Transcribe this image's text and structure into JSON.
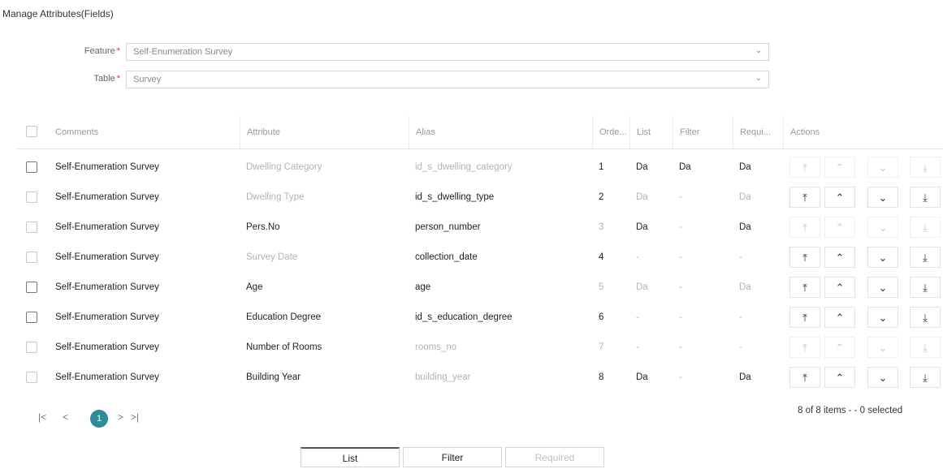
{
  "page": {
    "title": "Manage Attributes(Fields)"
  },
  "form": {
    "feature": {
      "label": "Feature",
      "value": "Self-Enumeration Survey"
    },
    "table": {
      "label": "Table",
      "value": "Survey"
    },
    "required_mark": "*"
  },
  "grid": {
    "columns": [
      "Comments",
      "Attribute",
      "Alias",
      "Orde...",
      "List",
      "Filter",
      "Requi...",
      "Actions"
    ],
    "rows": [
      {
        "comment": "Self-Enumeration Survey",
        "attribute": "Dwelling Category",
        "alias": "id_s_dwelling_category",
        "order": "1",
        "list": "Da",
        "filter": "Da",
        "required": "Da"
      },
      {
        "comment": "Self-Enumeration Survey",
        "attribute": "Dwelling Type",
        "alias": "id_s_dwelling_type",
        "order": "2",
        "list": "Da",
        "filter": "-",
        "required": "Da"
      },
      {
        "comment": "Self-Enumeration Survey",
        "attribute": "Pers.No",
        "alias": "person_number",
        "order": "3",
        "list": "Da",
        "filter": "-",
        "required": "Da"
      },
      {
        "comment": "Self-Enumeration Survey",
        "attribute": "Survey Date",
        "alias": "collection_date",
        "order": "4",
        "list": "-",
        "filter": "-",
        "required": "-"
      },
      {
        "comment": "Self-Enumeration Survey",
        "attribute": "Age",
        "alias": "age",
        "order": "5",
        "list": "Da",
        "filter": "-",
        "required": "Da"
      },
      {
        "comment": "Self-Enumeration Survey",
        "attribute": "Education Degree",
        "alias": "id_s_education_degree",
        "order": "6",
        "list": "-",
        "filter": "-",
        "required": "-"
      },
      {
        "comment": "Self-Enumeration Survey",
        "attribute": "Number of Rooms",
        "alias": "rooms_no",
        "order": "7",
        "list": "-",
        "filter": "-",
        "required": "-"
      },
      {
        "comment": "Self-Enumeration Survey",
        "attribute": "Building Year",
        "alias": "building_year",
        "order": "8",
        "list": "Da",
        "filter": "-",
        "required": "Da"
      }
    ],
    "action_icons": {
      "move_top": "⤒",
      "move_up": "⌃",
      "move_down": "⌄",
      "move_bottom": "⤓"
    }
  },
  "pager": {
    "first": "|<",
    "prev": "<",
    "current": "1",
    "next": ">",
    "last": ">|",
    "info": "8 of 8 items - - 0 selected"
  },
  "tabs": {
    "list": "List",
    "filter": "Filter",
    "required": "Required"
  },
  "colors": {
    "accent": "#2e8b9a"
  }
}
